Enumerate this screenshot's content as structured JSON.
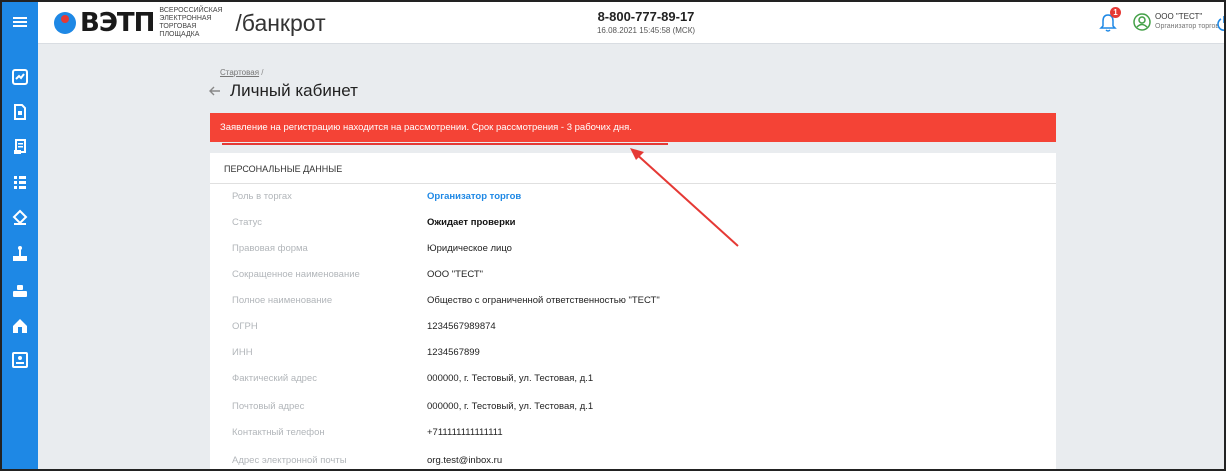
{
  "header": {
    "logo_name": "ВЭТП",
    "logo_sub": [
      "ВСЕРОССИЙСКАЯ",
      "ЭЛЕКТРОННАЯ",
      "ТОРГОВАЯ ПЛОЩАДКА"
    ],
    "section": "/банкрот",
    "phone": "8-800-777-89-17",
    "datetime": "16.08.2021 15:45:58 (МСК)",
    "notification_count": "1",
    "user_name": "ООО \"ТЕСТ\"",
    "user_role": "Организатор торгов"
  },
  "sidebar": {
    "icons": [
      "dashboard-icon",
      "document-icon",
      "scroll-icon",
      "list-icon",
      "gavel-icon",
      "auction-icon",
      "hammer-icon",
      "home-icon",
      "contact-card-icon"
    ]
  },
  "breadcrumb": {
    "home": "Стартовая",
    "separator": "/"
  },
  "page_title": "Личный кабинет",
  "alert": "Заявление на регистрацию находится на рассмотрении. Срок рассмотрения - 3 рабочих дня.",
  "card": {
    "header": "ПЕРСОНАЛЬНЫЕ ДАННЫЕ",
    "rows": [
      {
        "label": "Роль в торгах",
        "value": "Организатор торгов"
      },
      {
        "label": "Статус",
        "value": "Ожидает проверки"
      },
      {
        "label": "Правовая форма",
        "value": "Юридическое лицо"
      },
      {
        "label": "Сокращенное наименование",
        "value": "ООО \"ТЕСТ\""
      },
      {
        "label": "Полное наименование",
        "value": "Общество с ограниченной ответственностью \"ТЕСТ\""
      },
      {
        "label": "ОГРН",
        "value": "1234567989874"
      },
      {
        "label": "ИНН",
        "value": "1234567899"
      },
      {
        "label": "Фактический адрес",
        "value": "000000, г. Тестовый, ул. Тестовая, д.1"
      },
      {
        "label": "Почтовый адрес",
        "value": "000000, г. Тестовый, ул. Тестовая, д.1"
      },
      {
        "label": "Контактный телефон",
        "value": "+711111111111111"
      },
      {
        "label": "Адрес электронной почты",
        "value": "org.test@inbox.ru"
      }
    ]
  },
  "colors": {
    "sidebar": "#1e88e5",
    "alert": "#f44336",
    "link": "#1e88e5",
    "background": "#e9ecef"
  }
}
